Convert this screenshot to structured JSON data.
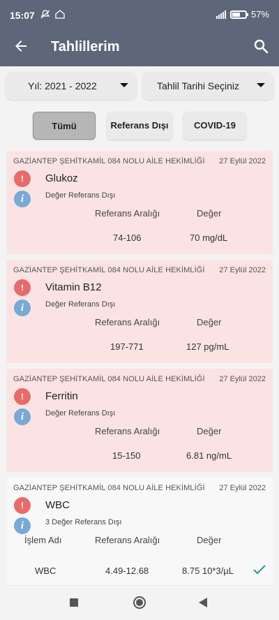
{
  "status_bar": {
    "time": "15:07",
    "battery": "57%"
  },
  "app_bar": {
    "title": "Tahlillerim"
  },
  "filters": {
    "year_label": "Yıl: 2021 - 2022",
    "date_label": "Tahlil Tarihi Seçiniz",
    "tabs": [
      {
        "label": "Tümü",
        "selected": true
      },
      {
        "label": "Referans Dışı",
        "selected": false
      },
      {
        "label": "COVID-19",
        "selected": false
      }
    ]
  },
  "results": [
    {
      "institution": "GAZİANTEP ŞEHİTKAMİL 084 NOLU AİLE HEKİMLİĞİ",
      "date": "27 Eylül 2022",
      "test_name": "Glukoz",
      "status": "Değer Referans Dışı",
      "ref_header": "Referans Aralığı",
      "val_header": "Değer",
      "ref_range": "74-106",
      "value": "70 mg/dL"
    },
    {
      "institution": "GAZİANTEP ŞEHİTKAMİL 084 NOLU AİLE HEKİMLİĞİ",
      "date": "27 Eylül 2022",
      "test_name": "Vitamin B12",
      "status": "Değer Referans Dışı",
      "ref_header": "Referans Aralığı",
      "val_header": "Değer",
      "ref_range": "197-771",
      "value": "127 pg/mL"
    },
    {
      "institution": "GAZİANTEP ŞEHİTKAMİL 084 NOLU AİLE HEKİMLİĞİ",
      "date": "27 Eylül 2022",
      "test_name": "Ferritin",
      "status": "Değer Referans Dışı",
      "ref_header": "Referans Aralığı",
      "val_header": "Değer",
      "ref_range": "15-150",
      "value": "6.81 ng/mL"
    },
    {
      "institution": "GAZİANTEP ŞEHİTKAMİL 084 NOLU AİLE HEKİMLİĞİ",
      "date": "27 Eylül 2022",
      "test_name": "WBC",
      "status": "3 Değer Referans Dışı",
      "name_header": "İşlem Adı",
      "ref_header": "Referans Aralığı",
      "val_header": "Değer",
      "rows": [
        {
          "name": "WBC",
          "ref_range": "4.49-12.68",
          "value": "8.75 10*3/µL"
        }
      ]
    }
  ],
  "colors": {
    "app_bar": "#5e6679",
    "out_of_range_card": "#fbe3e3",
    "warning": "#e86b6b",
    "info": "#79a9d4",
    "check": "#2a9d8f"
  }
}
